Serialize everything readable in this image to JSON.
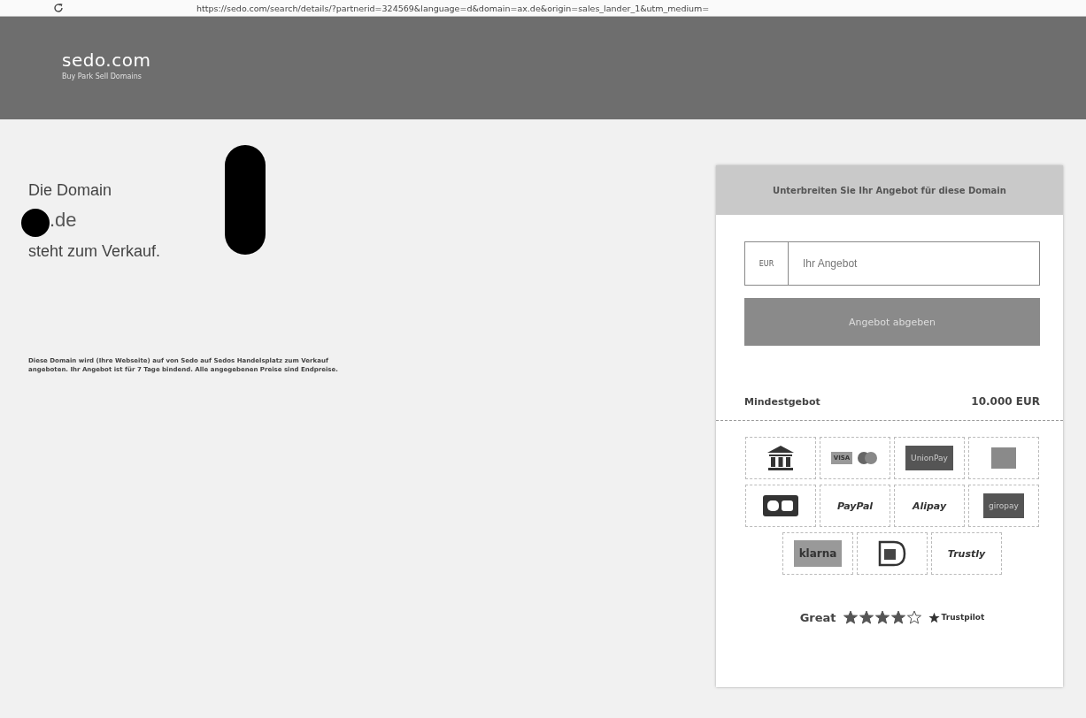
{
  "browser": {
    "url": "https://sedo.com/search/details/?partnerid=324569&language=d&domain=ax.de&origin=sales_lander_1&utm_medium="
  },
  "header": {
    "logo": "sedo.com",
    "tagline": "Buy Park Sell Domains"
  },
  "intro": {
    "line_1": "Die Domain",
    "domain": ".de",
    "line_3": "steht zum Verkauf.",
    "disclaimer": "Diese Domain wird (Ihre Webseite) auf von Sedo auf Sedos Handelsplatz zum Verkauf angeboten. Ihr Angebot ist für 7 Tage bindend. Alle angegebenen Preise sind Endpreise."
  },
  "offer": {
    "title": "Unterbreiten Sie Ihr Angebot für diese Domain",
    "currency": "EUR",
    "placeholder": "Ihr Angebot",
    "submit": "Angebot abgeben",
    "min_label": "Mindestgebot",
    "min_value": "10.000 EUR"
  },
  "payments": [
    {
      "kind": "bank"
    },
    {
      "kind": "cards",
      "label": "VISA"
    },
    {
      "kind": "dark",
      "label": "UnionPay"
    },
    {
      "kind": "box"
    },
    {
      "kind": "cb"
    },
    {
      "kind": "text",
      "label": "PayPal"
    },
    {
      "kind": "text",
      "label": "Alipay"
    },
    {
      "kind": "dark",
      "label": "giropay"
    },
    {
      "kind": "mid",
      "label": "klarna"
    },
    {
      "kind": "ideal"
    },
    {
      "kind": "text",
      "label": "Trustly"
    }
  ],
  "rating": {
    "label": "Great",
    "stars": 4,
    "brand": "Trustpilot"
  }
}
